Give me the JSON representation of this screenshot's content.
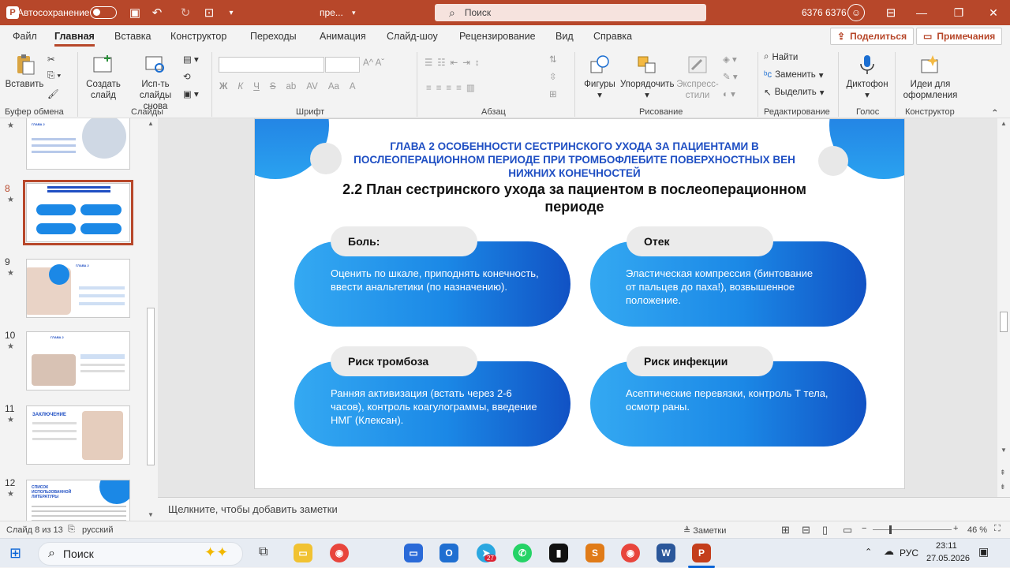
{
  "titlebar": {
    "autosave": "Автосохранение",
    "filename": "пре...",
    "search_placeholder": "Поиск",
    "user": "6376 6376"
  },
  "menu": {
    "tabs": [
      "Файл",
      "Главная",
      "Вставка",
      "Конструктор",
      "Переходы",
      "Анимация",
      "Слайд-шоу",
      "Рецензирование",
      "Вид",
      "Справка"
    ],
    "share": "Поделиться",
    "comments": "Примечания"
  },
  "ribbon": {
    "paste": "Вставить",
    "new_slide": "Создать слайд",
    "reuse": "Исп-ть слайды снова",
    "shapes": "Фигуры",
    "arrange": "Упорядочить",
    "quick_styles": "Экспресс-стили",
    "find": "Найти",
    "replace": "Заменить",
    "select": "Выделить",
    "dictation": "Диктофон",
    "designer": "Идеи для оформления",
    "groups": [
      "Буфер обмена",
      "Слайды",
      "Шрифт",
      "Абзац",
      "Рисование",
      "Редактирование",
      "Голос",
      "Конструктор"
    ],
    "font_buttons": [
      "Ж",
      "К",
      "Ч",
      "S",
      "ab",
      "AV",
      "Aa",
      "A"
    ]
  },
  "thumbnails": [
    {
      "num": "8",
      "thumb_title": "ГЛАВА 2",
      "selected": true
    },
    {
      "num": "9",
      "thumb_title": "ГЛАВА 2"
    },
    {
      "num": "10",
      "thumb_title": "ГЛАВА 2"
    },
    {
      "num": "11",
      "thumb_title": "ЗАКЛЮЧЕНИЕ"
    },
    {
      "num": "12",
      "thumb_title": "СПИСОК ИСПОЛЬЗОВАННОЙ ЛИТЕРАТУРЫ"
    }
  ],
  "slide": {
    "chapter_title": "ГЛАВА 2 ОСОБЕННОСТИ СЕСТРИНСКОГО УХОДА ЗА ПАЦИЕНТАМИ В ПОСЛЕОПЕРАЦИОННОМ ПЕРИОДЕ ПРИ ТРОМБОФЛЕБИТЕ ПОВЕРХНОСТНЫХ ВЕН НИЖНИХ КОНЕЧНОСТЕЙ",
    "section_title": "2.2 План сестринского ухода за пациентом в послеоперационном периоде",
    "cards": [
      {
        "label": "Боль:",
        "text": "Оценить по шкале, приподнять конечность, ввести анальгетики (по назначению)."
      },
      {
        "label": "Отек",
        "text": "Эластическая компрессия (бинтование от пальцев до паха!), возвышенное положение."
      },
      {
        "label": "Риск  тромбоза",
        "text": " Ранняя активизация (встать через 2-6 часов), контроль коагулограммы, введение НМГ (Клексан)."
      },
      {
        "label": "Риск инфекции",
        "text": "Асептические  перевязки,  контроль  Т тела, осмотр раны."
      }
    ]
  },
  "notes_placeholder": "Щелкните, чтобы добавить заметки",
  "status": {
    "slide_info": "Слайд 8 из 13",
    "language": "русский",
    "notes": "Заметки",
    "zoom": "46 %"
  },
  "taskbar": {
    "search": "Поиск",
    "lang": "РУС",
    "time": "23:11",
    "date": "27.05.2026",
    "badge": "27"
  },
  "colors": {
    "accent": "#b7472a",
    "pill_start": "#34a9f2",
    "pill_end": "#1152c4",
    "heading_blue": "#1f4fc3"
  }
}
